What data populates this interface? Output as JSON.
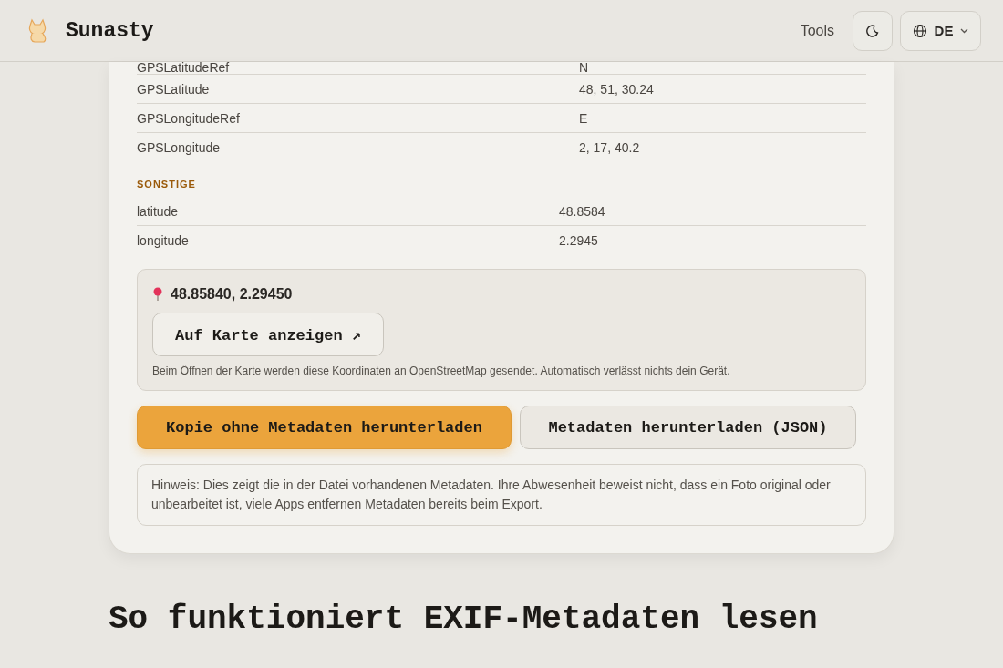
{
  "header": {
    "brand": "Sunasty",
    "nav": [
      {
        "label": "Tools"
      }
    ],
    "language": "DE"
  },
  "sections": [
    {
      "rows": [
        {
          "key": "GPSLatitudeRef",
          "value": "N"
        },
        {
          "key": "GPSLatitude",
          "value": "48, 51, 30.24"
        },
        {
          "key": "GPSLongitudeRef",
          "value": "E"
        },
        {
          "key": "GPSLongitude",
          "value": "2, 17, 40.2"
        }
      ]
    },
    {
      "title": "SONSTIGE",
      "rows": [
        {
          "key": "latitude",
          "value": "48.8584"
        },
        {
          "key": "longitude",
          "value": "2.2945"
        }
      ]
    }
  ],
  "location": {
    "coordinates": "48.85840, 2.29450",
    "map_button": "Auf Karte anzeigen ↗",
    "note": "Beim Öffnen der Karte werden diese Koordinaten an OpenStreetMap gesendet. Automatisch verlässt nichts dein Gerät."
  },
  "actions": [
    {
      "label": "Kopie ohne Metadaten herunterladen",
      "kind": "primary"
    },
    {
      "label": "Metadaten herunterladen (JSON)",
      "kind": "secondary"
    }
  ],
  "hint": "Hinweis: Dies zeigt die in der Datei vorhandenen Metadaten. Ihre Abwesenheit beweist nicht, dass ein Foto original oder unbearbeitet ist, viele Apps entfernen Metadaten bereits beim Export.",
  "heading": "So funktioniert EXIF-Metadaten lesen"
}
